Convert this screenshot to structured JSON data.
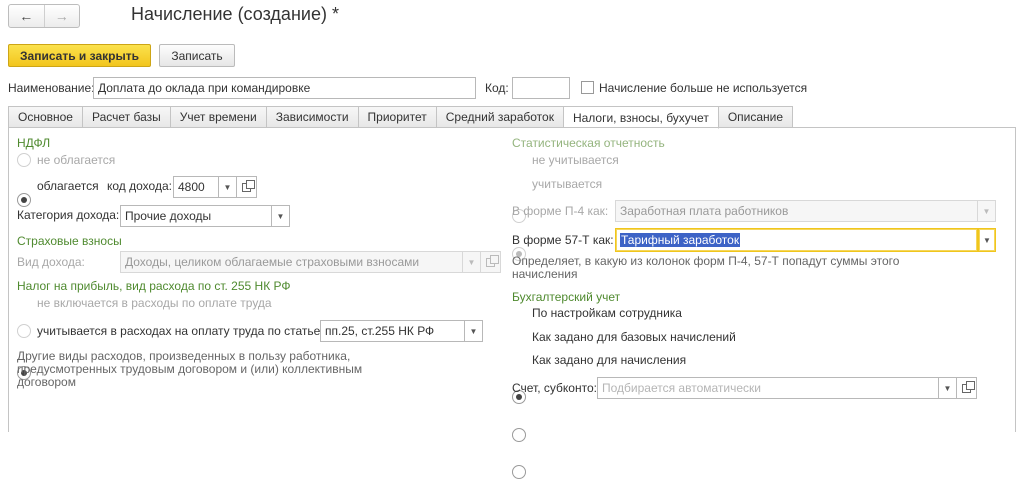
{
  "nav": {
    "back_glyph": "←",
    "forward_glyph": "→"
  },
  "title": "Начисление (создание) *",
  "toolbar": {
    "save_close": "Записать и закрыть",
    "save": "Записать"
  },
  "header": {
    "name_label": "Наименование:",
    "name_value": "Доплата до оклада при командировке",
    "code_label": "Код:",
    "code_value": "",
    "unused_label": "Начисление больше не используется"
  },
  "tabs": [
    {
      "label": "Основное"
    },
    {
      "label": "Расчет базы"
    },
    {
      "label": "Учет времени"
    },
    {
      "label": "Зависимости"
    },
    {
      "label": "Приоритет"
    },
    {
      "label": "Средний заработок"
    },
    {
      "label": "Налоги, взносы, бухучет"
    },
    {
      "label": "Описание"
    }
  ],
  "ndfl": {
    "heading": "НДФЛ",
    "not_taxed": "не облагается",
    "taxed": "облагается",
    "income_code_label": "код дохода:",
    "income_code_value": "4800",
    "category_label": "Категория дохода:",
    "category_value": "Прочие доходы"
  },
  "insurance": {
    "heading": "Страховые взносы",
    "income_type_label": "Вид дохода:",
    "income_type_value": "Доходы, целиком облагаемые страховыми взносами"
  },
  "profit_tax": {
    "heading": "Налог на прибыль, вид расхода по ст. 255 НК РФ",
    "not_included": "не включается в расходы по оплате труда",
    "included": "учитывается в расходах на оплату труда по статье:",
    "article_value": "пп.25, ст.255 НК РФ",
    "note": "Другие виды расходов, произведенных в пользу работника, предусмотренных трудовым договором и (или) коллективным договором"
  },
  "stats": {
    "heading": "Статистическая отчетность",
    "not_counted": "не учитывается",
    "counted": "учитывается",
    "p4_label": "В форме П-4 как:",
    "p4_value": "Заработная плата работников",
    "f57_label": "В форме 57-Т как:",
    "f57_value": "Тарифный заработок",
    "note": "Определяет, в какую из колонок форм П-4, 57-Т попадут суммы этого начисления"
  },
  "accounting": {
    "heading": "Бухгалтерский учет",
    "opt_employee": "По настройкам сотрудника",
    "opt_base": "Как задано для базовых начислений",
    "opt_accrual": "Как задано для начисления",
    "account_label": "Счет, субконто:",
    "account_placeholder": "Подбирается автоматически"
  },
  "icons": {
    "dropdown": "▼"
  }
}
